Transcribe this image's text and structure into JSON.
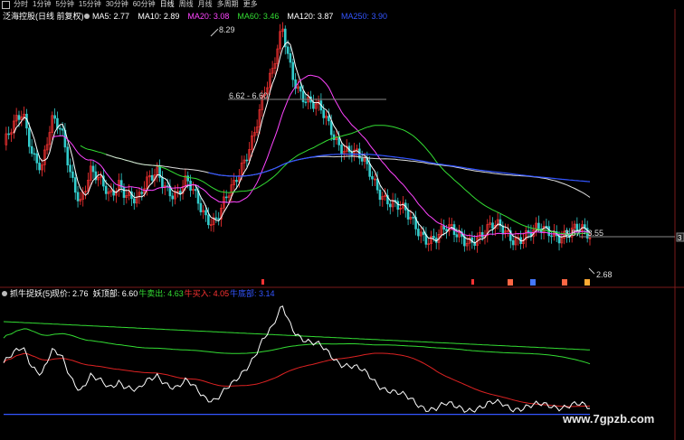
{
  "toolbar": {
    "icon": "window-icon",
    "items": [
      "分时",
      "1分钟",
      "5分钟",
      "15分钟",
      "30分钟",
      "60分钟",
      "日线",
      "周线",
      "月线",
      "多周期",
      "更多"
    ],
    "active_index": 6
  },
  "main_header": {
    "title": "泛海控股(日线 前复权)",
    "indicators": [
      {
        "label": "MA5: 2.77",
        "color": "#ffffff"
      },
      {
        "label": "MA10: 2.89",
        "color": "#ffffff"
      },
      {
        "label": "MA20: 3.08",
        "color": "#ff44ff"
      },
      {
        "label": "MA60: 3.46",
        "color": "#33dd33"
      },
      {
        "label": "MA120: 3.87",
        "color": "#ffffff"
      },
      {
        "label": "MA250: 3.90",
        "color": "#3355ff"
      }
    ]
  },
  "main_annotations": {
    "high": "8.29",
    "mid": "6.62 - 6.60",
    "level": "3.57 - 3.55",
    "low": "2.68",
    "right_axis": "3"
  },
  "sub_header": {
    "title": "抓牛捉妖(5)",
    "items": [
      {
        "label": "现价: 2.76",
        "color": "#ffffff"
      },
      {
        "label": "妖顶部: 6.60",
        "color": "#ffffff"
      },
      {
        "label": "牛卖出: 4.63",
        "color": "#33dd33"
      },
      {
        "label": "牛买入: 4.05",
        "color": "#ff3333"
      },
      {
        "label": "牛底部: 3.14",
        "color": "#3355ff"
      }
    ]
  },
  "chart_data": [
    {
      "type": "line",
      "title": "泛海控股(日线 前复权)",
      "series": [
        {
          "name": "MA5",
          "color": "#ffffff",
          "last": 2.77
        },
        {
          "name": "MA10",
          "color": "#ffffff",
          "last": 2.89
        },
        {
          "name": "MA20",
          "color": "#ff44ff",
          "last": 3.08
        },
        {
          "name": "MA60",
          "color": "#33dd33",
          "last": 3.46
        },
        {
          "name": "MA120",
          "color": "#ffffff",
          "last": 3.87
        },
        {
          "name": "MA250",
          "color": "#3355ff",
          "last": 3.9
        }
      ],
      "price_path": [
        5.6,
        5.9,
        6.3,
        5.5,
        5.2,
        6.1,
        5.8,
        4.9,
        4.4,
        5.0,
        4.6,
        4.3,
        4.8,
        4.5,
        4.2,
        4.6,
        5.0,
        4.7,
        4.4,
        4.6,
        4.3,
        4.0,
        3.9,
        4.2,
        4.5,
        5.2,
        6.0,
        6.8,
        7.2,
        8.29,
        7.4,
        6.9,
        6.5,
        6.3,
        6.0,
        5.7,
        5.5,
        5.2,
        4.9,
        4.6,
        4.4,
        4.1,
        3.8,
        3.6,
        3.5,
        3.45,
        3.5,
        3.4,
        3.42,
        3.48,
        3.45,
        3.55,
        3.6,
        3.5,
        3.45,
        3.4,
        3.5,
        3.6,
        3.55,
        3.5,
        3.45,
        3.4
      ],
      "marked_values": [
        8.29,
        6.62,
        6.6,
        3.57,
        3.55,
        2.68
      ]
    },
    {
      "type": "line",
      "title": "抓牛捉妖(5)",
      "series": [
        {
          "name": "现价",
          "color": "#ffffff",
          "last": 2.76
        },
        {
          "name": "妖顶部",
          "color": "#33dd33",
          "last": 6.6
        },
        {
          "name": "牛卖出",
          "color": "#33dd33",
          "last": 4.63
        },
        {
          "name": "牛买入",
          "color": "#ff3333",
          "last": 4.05
        },
        {
          "name": "牛底部",
          "color": "#3355ff",
          "last": 3.14
        }
      ]
    }
  ],
  "watermark": "www.7gpzb.com"
}
